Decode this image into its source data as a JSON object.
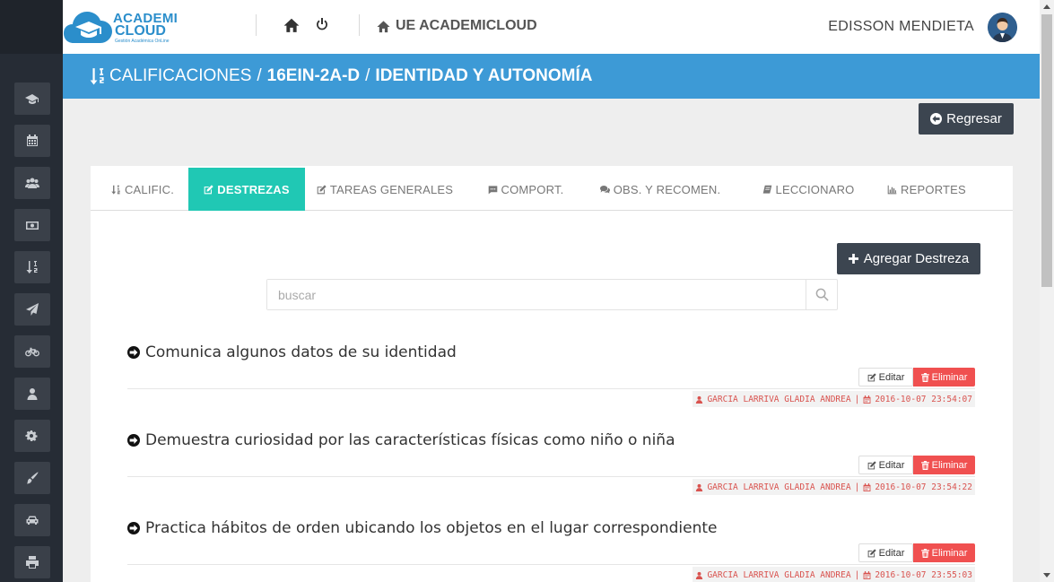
{
  "app": {
    "brand_line1": "ACADEMI",
    "brand_line2": "CLOUD",
    "brand_tagline": "Gestión Académica OnLine",
    "school_name": "UE ACADEMICLOUD",
    "user_name": "EDISSON MENDIETA"
  },
  "sidebar": {
    "icons": [
      "graduation-cap-icon",
      "calendar-icon",
      "users-icon",
      "money-icon",
      "sort-numeric-icon",
      "paper-plane-icon",
      "bicycle-icon",
      "user-icon",
      "cogs-icon",
      "paint-brush-icon",
      "car-icon",
      "print-icon"
    ]
  },
  "header": {
    "breadcrumb_root": "CALIFICACIONES",
    "breadcrumb_course": "16EIN-2A-D",
    "breadcrumb_subject": "IDENTIDAD Y AUTONOMÍA",
    "separator": "/"
  },
  "toolbar": {
    "back_label": "Regresar"
  },
  "tabs": [
    {
      "label": "CALIFIC.",
      "icon": "sort-numeric-icon",
      "active": false
    },
    {
      "label": "DESTREZAS",
      "icon": "edit-icon",
      "active": true
    },
    {
      "label": "TAREAS GENERALES",
      "icon": "edit-icon",
      "active": false
    },
    {
      "label": "COMPORT.",
      "icon": "comment-icon",
      "active": false
    },
    {
      "label": "OBS. Y RECOMEN.",
      "icon": "comments-icon",
      "active": false
    },
    {
      "label": "LECCIONARO",
      "icon": "book-icon",
      "active": false
    },
    {
      "label": "REPORTES",
      "icon": "bar-chart-icon",
      "active": false
    }
  ],
  "content": {
    "add_label": "Agregar Destreza",
    "search_placeholder": "buscar",
    "edit_label": "Editar",
    "delete_label": "Eliminar",
    "items": [
      {
        "title": "Comunica algunos datos de su identidad",
        "author": "GARCIA LARRIVA GLADIA ANDREA",
        "sep": "|",
        "date": "2016-10-07 23:54:07"
      },
      {
        "title": "Demuestra curiosidad por las características físicas como niño o niña",
        "author": "GARCIA LARRIVA GLADIA ANDREA",
        "sep": "|",
        "date": "2016-10-07 23:54:22"
      },
      {
        "title": "Practica hábitos de orden ubicando los objetos en el lugar correspondiente",
        "author": "GARCIA LARRIVA GLADIA ANDREA",
        "sep": "|",
        "date": "2016-10-07 23:55:03"
      }
    ]
  },
  "colors": {
    "sidebar": "#262c35",
    "header_blue": "#3d9ad6",
    "tab_active": "#20c8b4",
    "dark_button": "#3c4550",
    "danger": "#f05050"
  }
}
